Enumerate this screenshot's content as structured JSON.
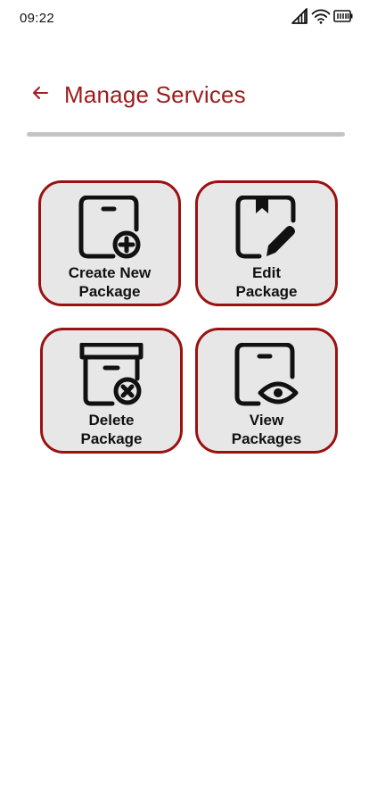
{
  "status_bar": {
    "time": "09:22",
    "icons": [
      "signal-icon",
      "wifi-icon",
      "battery-icon"
    ]
  },
  "header": {
    "back_icon": "arrow-left-icon",
    "title": "Manage Services"
  },
  "colors": {
    "accent": "#9b1c1c",
    "tile_border": "#9b1111",
    "tile_background": "#e7e7e7",
    "divider": "#c4c4c4"
  },
  "tiles": [
    {
      "label": "Create New\nPackage",
      "icon": "package-add-icon"
    },
    {
      "label": "Edit\nPackage",
      "icon": "package-edit-icon"
    },
    {
      "label": "Delete\nPackage",
      "icon": "package-delete-icon"
    },
    {
      "label": "View\nPackages",
      "icon": "package-view-icon"
    }
  ]
}
